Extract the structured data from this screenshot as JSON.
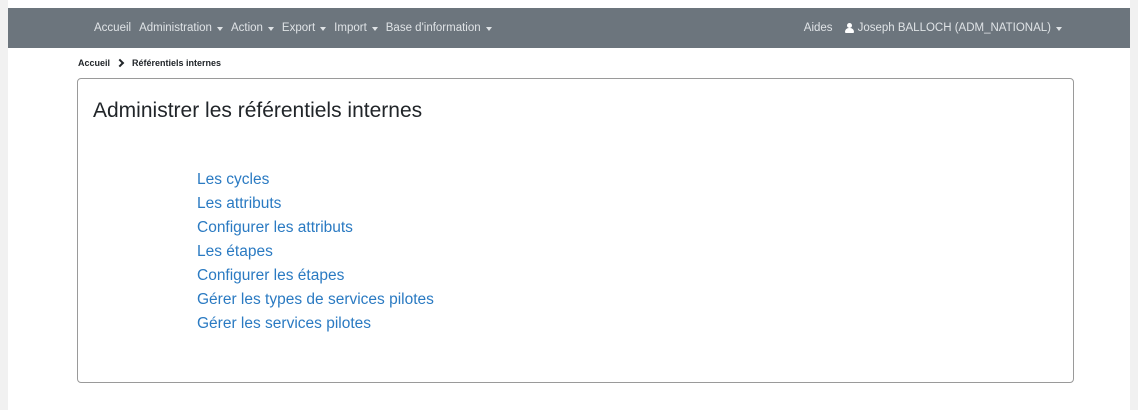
{
  "navbar": {
    "menu": [
      {
        "label": "Accueil",
        "dropdown": false
      },
      {
        "label": "Administration",
        "dropdown": true
      },
      {
        "label": "Action",
        "dropdown": true
      },
      {
        "label": "Export",
        "dropdown": true
      },
      {
        "label": "Import",
        "dropdown": true
      },
      {
        "label": "Base d'information",
        "dropdown": true
      }
    ],
    "help_label": "Aides",
    "user_label": "Joseph BALLOCH (ADM_NATIONAL)",
    "user_icon": "user-icon",
    "background_color": "#6c757d"
  },
  "breadcrumb": {
    "home": "Accueil",
    "separator_icon": "chevron-right-icon",
    "current": "Référentiels internes"
  },
  "main": {
    "title": "Administrer les référentiels internes",
    "link_color": "#2a7ac2",
    "links": [
      "Les cycles",
      "Les attributs",
      "Configurer les attributs",
      "Les étapes",
      "Configurer les étapes",
      "Gérer les types de services pilotes",
      "Gérer les services pilotes"
    ]
  }
}
